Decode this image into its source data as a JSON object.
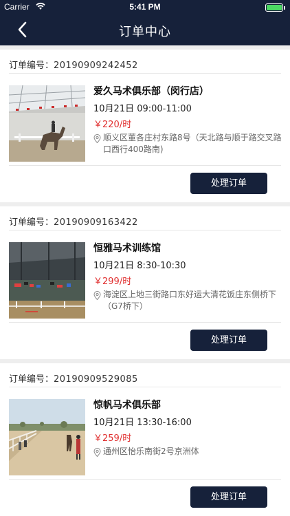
{
  "status_bar": {
    "carrier": "Carrier",
    "time": "5:41 PM"
  },
  "header": {
    "title": "订单中心"
  },
  "order_label": "订单编号：",
  "orders": [
    {
      "order_no": "20190909242452",
      "name": "爱久马术俱乐部（闵行店）",
      "time": "10月21日 09:00-11:00",
      "price": "￥220/时",
      "address": "顺义区董各庄村东路8号（天北路与顺于路交叉路口西行400路南)",
      "button": "处理订单"
    },
    {
      "order_no": "20190909163422",
      "name": "恒雅马术训练馆",
      "time": "10月21日 8:30-10:30",
      "price": "￥299/时",
      "address": "海淀区上地三街路口东好运大清花饭庄东侧桥下（G7桥下）",
      "button": "处理订单"
    },
    {
      "order_no": "20190909529085",
      "name": "惊帆马术俱乐部",
      "time": "10月21日 13:30-16:00",
      "price": "￥259/时",
      "address": "通州区怡乐南街2号京洲体",
      "button": "处理订单"
    }
  ],
  "colors": {
    "navy": "#16213a",
    "price_red": "#e02d2d",
    "battery_green": "#4cd964"
  }
}
